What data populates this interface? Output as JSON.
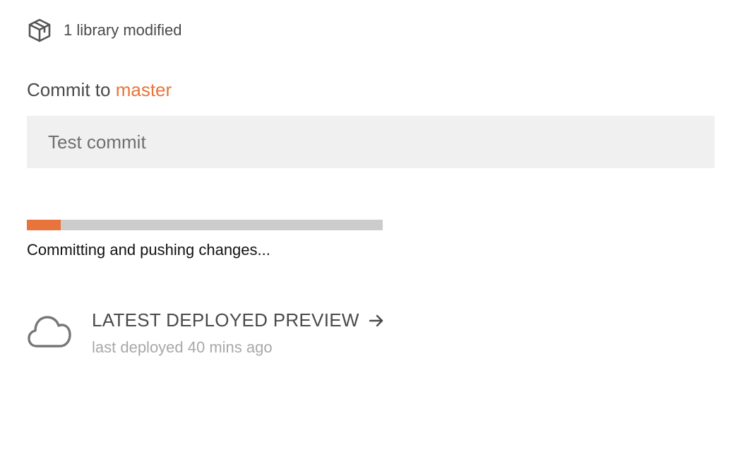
{
  "changes": {
    "icon": "package-icon",
    "summary": "1 library modified"
  },
  "commit": {
    "prefix": "Commit to",
    "branch": "master",
    "branch_color": "#e8743b",
    "message_value": "",
    "message_placeholder": "Test commit"
  },
  "progress": {
    "fraction": 0.095,
    "fill_color": "#e8743b",
    "track_color": "#cccccc",
    "status": "Committing and pushing changes..."
  },
  "preview": {
    "icon": "cloud-icon",
    "link_label": "LATEST DEPLOYED PREVIEW",
    "link_icon": "arrow-right-icon",
    "subtitle": "last deployed 40 mins ago"
  }
}
